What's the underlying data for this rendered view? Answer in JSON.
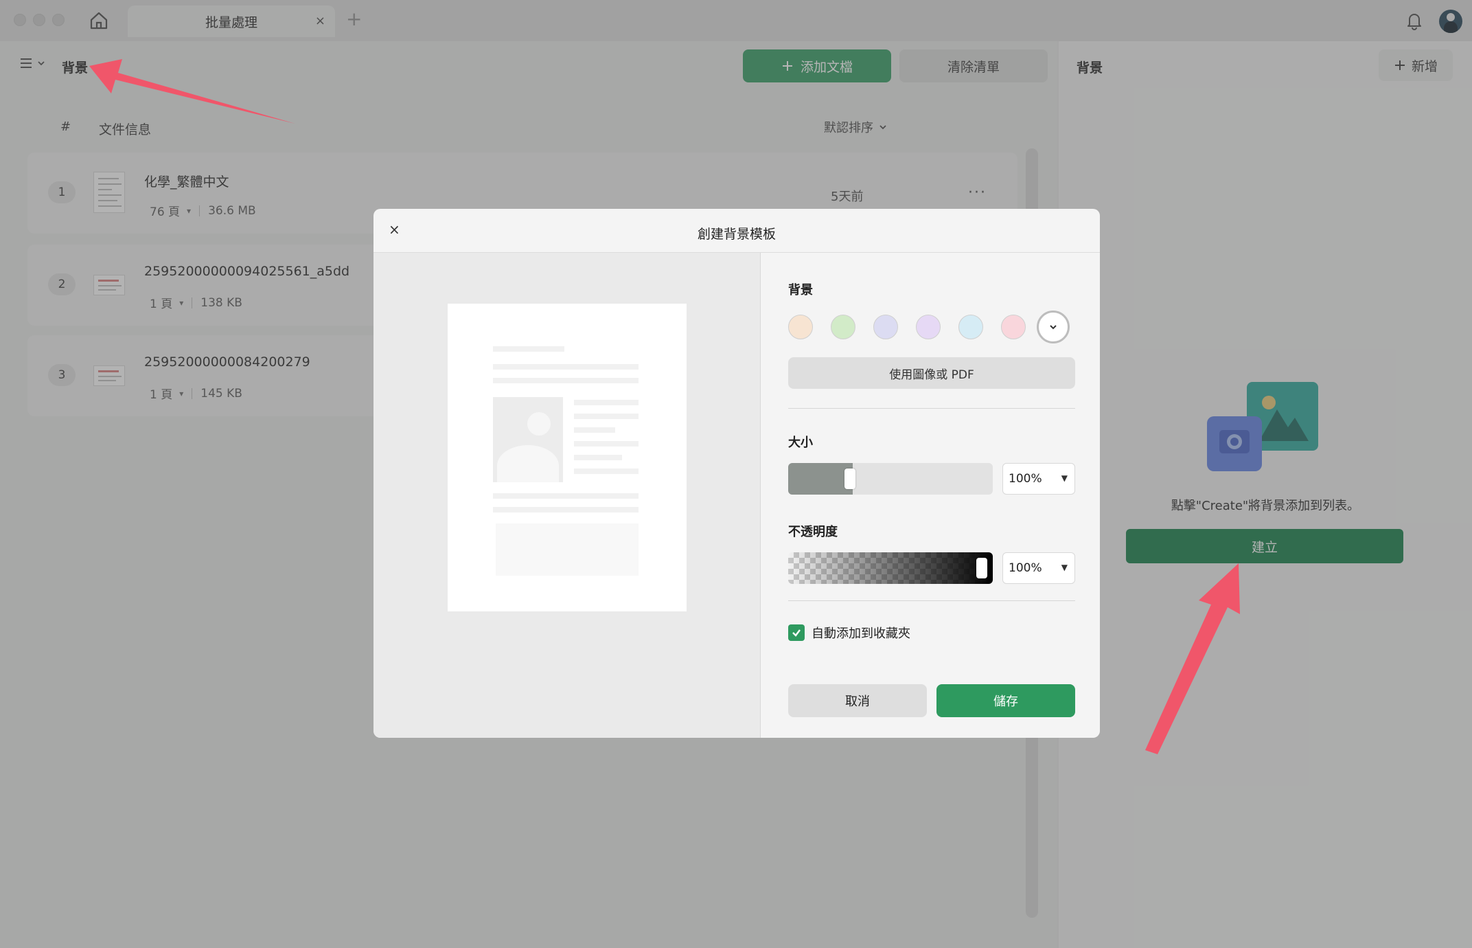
{
  "titlebar": {
    "tab_label": "批量處理",
    "tab_close": "×",
    "new_tab": "+"
  },
  "main": {
    "title": "背景",
    "add_file_label": "添加文檔",
    "clear_list_label": "清除清單",
    "col_number": "#",
    "col_file_info": "文件信息",
    "sort_label": "默認排序",
    "files": [
      {
        "index": "1",
        "name": "化學_繁體中文",
        "pages": "76 頁",
        "size": "36.6 MB",
        "time": "5天前",
        "more": "···"
      },
      {
        "index": "2",
        "name": "25952000000094025561_a5dd",
        "pages": "1 頁",
        "size": "138 KB"
      },
      {
        "index": "3",
        "name": "25952000000084200279",
        "pages": "1 頁",
        "size": "145 KB"
      }
    ]
  },
  "side": {
    "title": "背景",
    "new_label": "新增",
    "hint": "點擊\"Create\"將背景添加到列表。",
    "create_label": "建立"
  },
  "dialog": {
    "close": "×",
    "title": "創建背景模板",
    "background_label": "背景",
    "swatches": [
      "#f7e4d2",
      "#d2ebc8",
      "#dcdcf2",
      "#e6d9f5",
      "#d6ecf5",
      "#f9d6dc"
    ],
    "use_image_label": "使用圖像或 PDF",
    "size_label": "大小",
    "size_value": "100%",
    "size_fraction": 0.27,
    "opacity_label": "不透明度",
    "opacity_value": "100%",
    "opacity_fraction": 1.0,
    "auto_fav_label": "自動添加到收藏夾",
    "auto_fav_checked": true,
    "cancel_label": "取消",
    "save_label": "儲存"
  },
  "colors": {
    "accent_green": "#2e9a5f",
    "create_green": "#0f7a44",
    "arrow_red": "#f0566a"
  },
  "icons": {
    "home": "home-icon",
    "bell": "bell-icon",
    "menu": "menu-icon",
    "close": "close-icon",
    "chevron": "chevron-down-icon",
    "more": "more-icon"
  }
}
